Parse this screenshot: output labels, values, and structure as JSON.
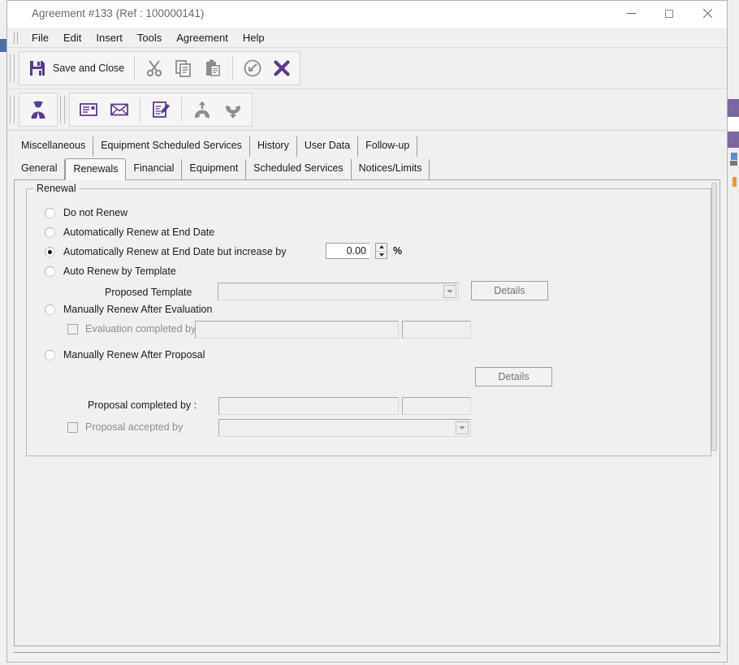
{
  "window": {
    "title": "Agreement #133 (Ref : 100000141)",
    "controls": {
      "minimize": "minimize",
      "maximize": "maximize",
      "close": "close"
    }
  },
  "menubar": {
    "items": [
      {
        "label": "File"
      },
      {
        "label": "Edit"
      },
      {
        "label": "Insert"
      },
      {
        "label": "Tools"
      },
      {
        "label": "Agreement"
      },
      {
        "label": "Help"
      }
    ]
  },
  "toolbar_primary": {
    "save_and_close_label": "Save and Close",
    "icons": [
      {
        "name": "save-icon"
      },
      {
        "name": "cut-scissors-icon"
      },
      {
        "name": "copy-icon"
      },
      {
        "name": "paste-icon"
      },
      {
        "name": "undo-icon"
      },
      {
        "name": "delete-x-icon"
      }
    ]
  },
  "toolbar_secondary": {
    "icons": [
      {
        "name": "contact-person-icon"
      },
      {
        "name": "business-card-icon"
      },
      {
        "name": "envelope-icon"
      },
      {
        "name": "note-edit-icon"
      },
      {
        "name": "phone-outgoing-icon"
      },
      {
        "name": "phone-incoming-icon"
      }
    ]
  },
  "tabs_row1": [
    {
      "label": "Miscellaneous",
      "active": false
    },
    {
      "label": "Equipment Scheduled Services",
      "active": false
    },
    {
      "label": "History",
      "active": false
    },
    {
      "label": "User Data",
      "active": false
    },
    {
      "label": "Follow-up",
      "active": false
    }
  ],
  "tabs_row2": [
    {
      "label": "General",
      "active": false
    },
    {
      "label": "Renewals",
      "active": true
    },
    {
      "label": "Financial",
      "active": false
    },
    {
      "label": "Equipment",
      "active": false
    },
    {
      "label": "Scheduled Services",
      "active": false
    },
    {
      "label": "Notices/Limits",
      "active": false
    }
  ],
  "renewal": {
    "group_title": "Renewal",
    "options": [
      {
        "label": "Do not Renew",
        "selected": false
      },
      {
        "label": "Automatically Renew at End Date",
        "selected": false
      },
      {
        "label": "Automatically Renew at End Date but increase by",
        "selected": true
      },
      {
        "label": "Auto Renew by Template",
        "selected": false
      },
      {
        "label": "Manually Renew After Evaluation",
        "selected": false
      },
      {
        "label": "Manually Renew After Proposal",
        "selected": false
      }
    ],
    "increase_value": "0.00",
    "percent_symbol": "%",
    "proposed_template_label": "Proposed Template",
    "proposed_template_value": "",
    "template_details_button": "Details",
    "evaluation_checkbox_label": "Evaluation completed by",
    "evaluation_completed_by_value": "",
    "evaluation_date_value": "",
    "proposal_details_button": "Details",
    "proposal_completed_by_label": "Proposal completed by :",
    "proposal_completed_by_value": "",
    "proposal_date_value": "",
    "proposal_accepted_checkbox_label": "Proposal accepted by",
    "proposal_accepted_by_value": ""
  },
  "colors": {
    "accent_purple": "#5b3a8c",
    "icon_gray": "#8d8d8d",
    "window_bg": "#f0f0f0",
    "text": "#1b1b1b",
    "disabled_text": "#8d8d8d"
  }
}
